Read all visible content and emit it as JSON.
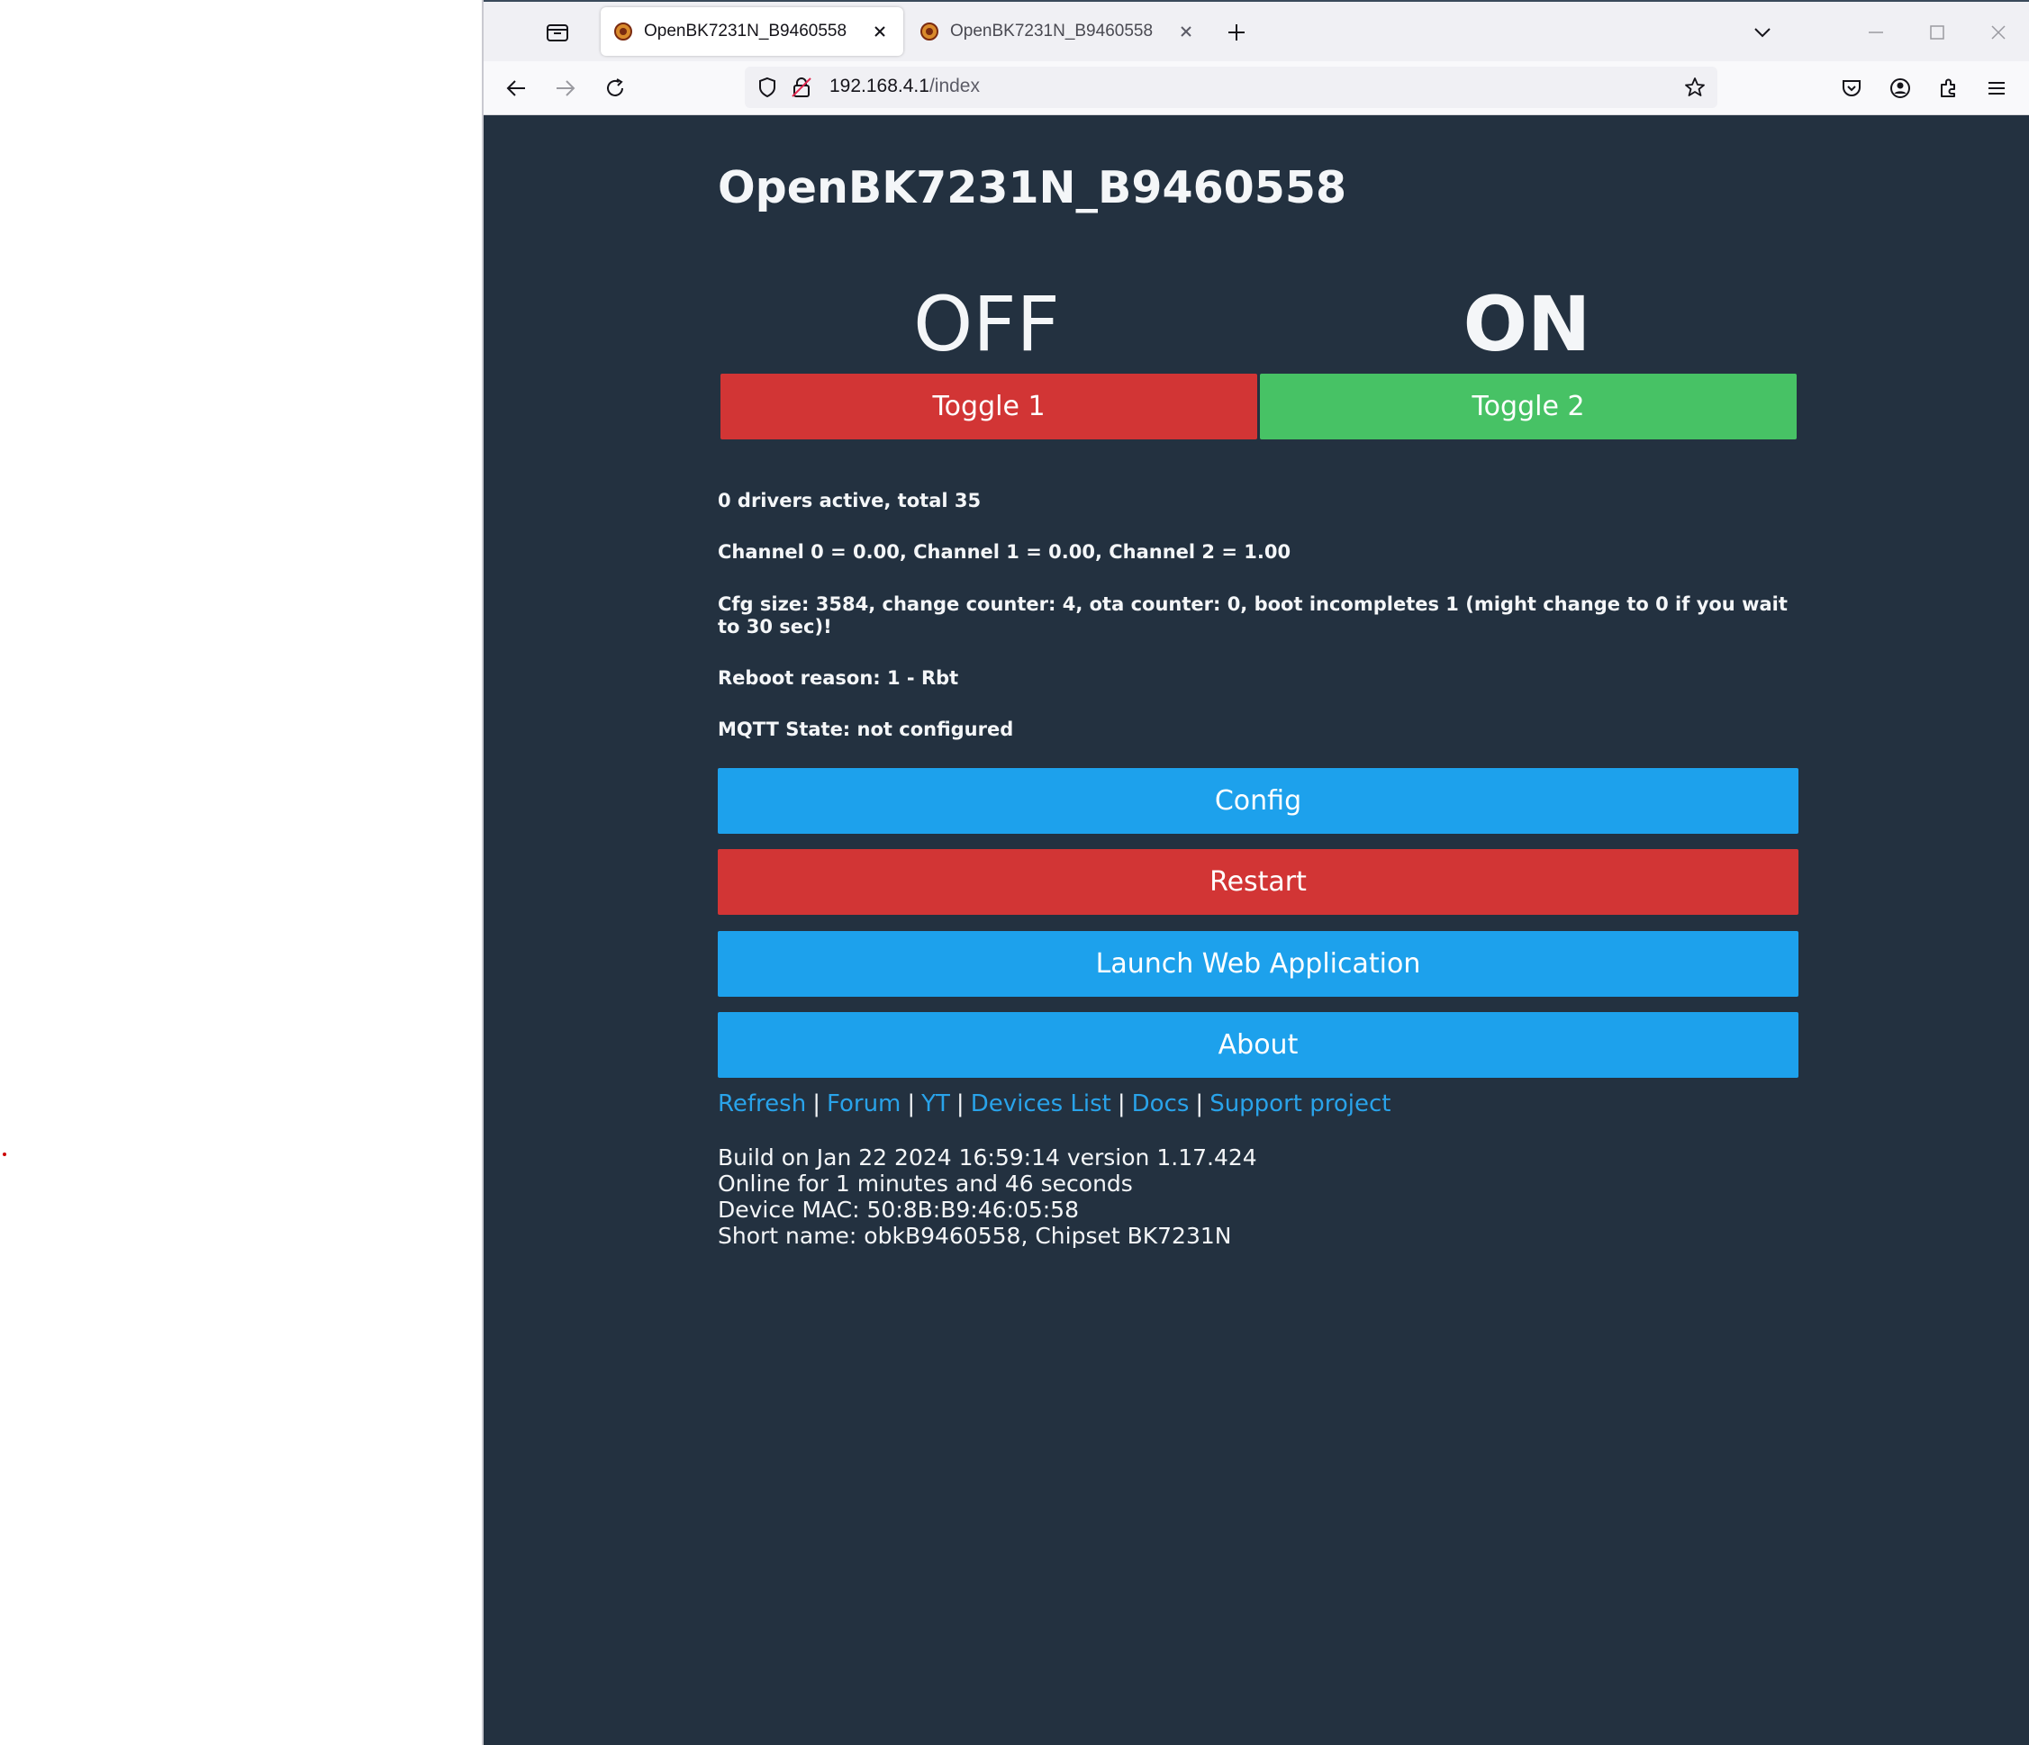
{
  "browser": {
    "tabs": [
      {
        "title": "OpenBK7231N_B9460558",
        "active": true
      },
      {
        "title": "OpenBK7231N_B9460558",
        "active": false
      }
    ],
    "url_host": "192.168.4.1",
    "url_path": "/index"
  },
  "page": {
    "title": "OpenBK7231N_B9460558",
    "toggles": [
      {
        "state": "OFF",
        "label": "Toggle 1",
        "color": "#d23535"
      },
      {
        "state": "ON",
        "label": "Toggle 2",
        "color": "#47c265"
      }
    ],
    "info": {
      "drivers": "0 drivers active, total 35",
      "channels": "Channel 0 = 0.00, Channel 1 = 0.00, Channel 2 = 1.00",
      "cfg": "Cfg size: 3584, change counter: 4, ota counter: 0, boot incompletes 1 (might change to 0 if you wait to 30 sec)!",
      "reboot": "Reboot reason: 1 - Rbt",
      "mqtt": "MQTT State: not configured"
    },
    "buttons": {
      "config": "Config",
      "restart": "Restart",
      "launch": "Launch Web Application",
      "about": "About"
    },
    "links": {
      "refresh": "Refresh",
      "forum": "Forum",
      "yt": "YT",
      "devices": "Devices List",
      "docs": "Docs",
      "support": "Support project",
      "separator": "|"
    },
    "footer": {
      "build": "Build on Jan 22 2024 16:59:14 version 1.17.424",
      "online": "Online for 1 minutes and 46 seconds",
      "mac": "Device MAC: 50:8B:B9:46:05:58",
      "short": "Short name: obkB9460558, Chipset BK7231N"
    }
  },
  "colors": {
    "background": "#233140",
    "blue": "#1da1ec",
    "red": "#d23535",
    "green": "#47c265",
    "link": "#29a3ea"
  }
}
